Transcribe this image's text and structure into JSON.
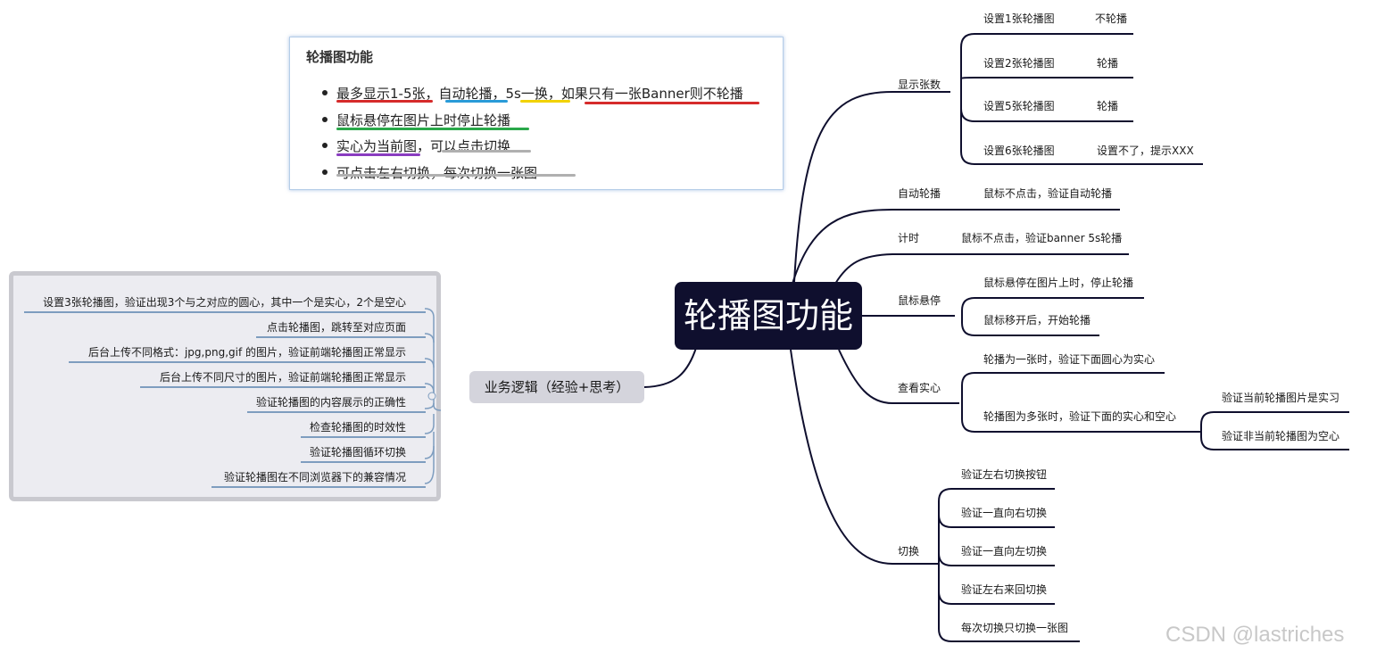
{
  "central": "轮播图功能",
  "business_node": "业务逻辑（经验+思考）",
  "business_items": [
    "设置3张轮播图，验证出现3个与之对应的圆心，其中一个是实心，2个是空心",
    "点击轮播图，跳转至对应页面",
    "后台上传不同格式：jpg,png,gif 的图片，验证前端轮播图正常显示",
    "后台上传不同尺寸的图片，验证前端轮播图正常显示",
    "验证轮播图的内容展示的正确性",
    "检查轮播图的时效性",
    "验证轮播图循环切换",
    "验证轮播图在不同浏览器下的兼容情况"
  ],
  "note": {
    "title": "轮播图功能",
    "lines": [
      "最多显示1-5张，自动轮播，5s一换，如果只有一张Banner则不轮播",
      "鼠标悬停在图片上时停止轮播",
      "实心为当前图，可以点击切换",
      "可点击左右切换，每次切换一张图"
    ],
    "underline_colors": [
      "#d62b2b",
      "#2a9bd8",
      "#f2d200",
      "#2aa84a",
      "#8a3cc0",
      "#b0b0b0"
    ]
  },
  "branches": {
    "display_count": {
      "label": "显示张数",
      "items": [
        {
          "text": "设置1张轮播图",
          "result": "不轮播"
        },
        {
          "text": "设置2张轮播图",
          "result": "轮播"
        },
        {
          "text": "设置5张轮播图",
          "result": "轮播"
        },
        {
          "text": "设置6张轮播图",
          "result": "设置不了，提示XXX"
        }
      ]
    },
    "auto_play": {
      "label": "自动轮播",
      "item": "鼠标不点击，验证自动轮播"
    },
    "timer": {
      "label": "计时",
      "item": "鼠标不点击，验证banner 5s轮播"
    },
    "hover": {
      "label": "鼠标悬停",
      "items": [
        "鼠标悬停在图片上时，停止轮播",
        "鼠标移开后，开始轮播"
      ]
    },
    "dots": {
      "label": "查看实心",
      "items": [
        "轮播为一张时，验证下面圆心为实心",
        "轮播图为多张时，验证下面的实心和空心"
      ],
      "sub_items": [
        "验证当前轮播图片是实习",
        "验证非当前轮播图为空心"
      ]
    },
    "switch": {
      "label": "切换",
      "items": [
        "验证左右切换按钮",
        "验证一直向右切换",
        "验证一直向左切换",
        "验证左右来回切换",
        "每次切换只切换一张图"
      ]
    }
  },
  "colors": {
    "line": "#0f0f2e",
    "central_bg": "#0f0f2e",
    "business_bg": "#d4d4dc",
    "panel_line": "#7e9dbf"
  },
  "watermark": "CSDN @lastriches"
}
